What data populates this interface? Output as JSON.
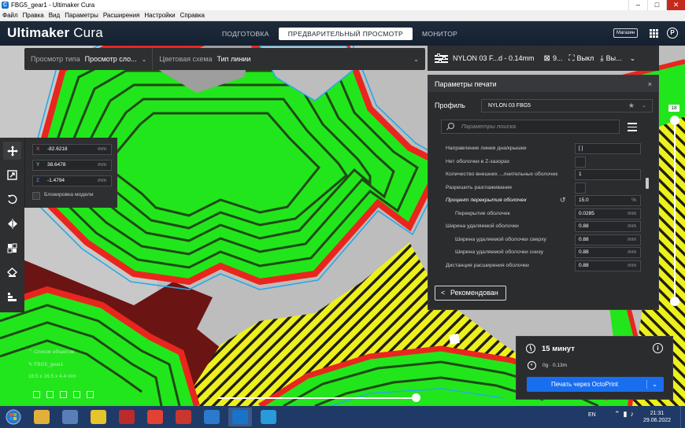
{
  "window": {
    "title": "FBG5_gear1 - Ultimaker Cura",
    "app_icon": "C",
    "minimize": "–",
    "maximize": "□",
    "close": "✕"
  },
  "menu": [
    "Файл",
    "Правка",
    "Вид",
    "Параметры",
    "Расширения",
    "Настройки",
    "Справка"
  ],
  "header": {
    "logo_bold": "Ultimaker",
    "logo_light": " Cura",
    "stages": [
      "ПОДГОТОВКА",
      "ПРЕДВАРИТЕЛЬНЫЙ ПРОСМОТР",
      "МОНИТОР"
    ],
    "active_stage": 1,
    "marketplace": "Магазин",
    "profile_letter": "P"
  },
  "view_toolbar": {
    "view_type_label": "Просмотр типа",
    "view_type_value": "Просмотр сло...",
    "color_scheme_label": "Цветовая схема",
    "color_scheme_value": "Тип линии",
    "chevron": "⌄"
  },
  "print_setup_bar": {
    "profile_summary": "NYLON 03 F...d - 0.14mm",
    "infill_value": "9...",
    "support_value": "Выкл",
    "adhesion_value": "Вы...",
    "chevron": "⌄"
  },
  "print_panel": {
    "title": "Параметры печати",
    "close": "×",
    "profile_label": "Профиль",
    "profile_value": "NYLON 03 FBG5",
    "star": "★",
    "chevron": "⌄",
    "search_placeholder": "Параметры поиска",
    "settings": [
      {
        "name": "Направление линии дна/крышки",
        "value": "[ ]",
        "unit": "",
        "type": "text",
        "sub": false,
        "highlight": false
      },
      {
        "name": "Нет оболочки в Z-зазорах",
        "value": "",
        "unit": "",
        "type": "check",
        "sub": false,
        "highlight": false
      },
      {
        "name": "Количество внешних ...лнительных оболочек",
        "value": "1",
        "unit": "",
        "type": "text",
        "sub": false,
        "highlight": false
      },
      {
        "name": "Разрешить разглаживание",
        "value": "",
        "unit": "",
        "type": "check",
        "sub": false,
        "highlight": false
      },
      {
        "name": "Процент перекрытия оболочек",
        "value": "15.0",
        "unit": "%",
        "type": "text",
        "sub": false,
        "highlight": true
      },
      {
        "name": "Перекрытие оболочек",
        "value": "0.0285",
        "unit": "mm",
        "type": "text",
        "sub": true,
        "highlight": false
      },
      {
        "name": "Ширина удаляемой оболочки",
        "value": "0.88",
        "unit": "mm",
        "type": "text",
        "sub": false,
        "highlight": false
      },
      {
        "name": "Ширина удаляемой оболочки сверху",
        "value": "0.88",
        "unit": "mm",
        "type": "text",
        "sub": true,
        "highlight": false
      },
      {
        "name": "Ширина удаляемой оболочки снизу",
        "value": "0.88",
        "unit": "mm",
        "type": "text",
        "sub": true,
        "highlight": false
      },
      {
        "name": "Дистанция расширения оболочки",
        "value": "0.88",
        "unit": "mm",
        "type": "text",
        "sub": false,
        "highlight": false
      }
    ],
    "reset_glyph": "↺",
    "recommended_button": "Рекомендован",
    "recommended_arrow": "<"
  },
  "move_tool": {
    "x_label": "X",
    "x_value": "-82.6218",
    "x_unit": "mm",
    "y_label": "Y",
    "y_value": "38.6478",
    "y_unit": "mm",
    "z_label": "Z",
    "z_value": "-1.4794",
    "z_unit": "mm",
    "lock_label": "Блокировка модели",
    "axis_colors": {
      "x": "#e0403c",
      "y": "#4fc34a",
      "z": "#3d7ce0"
    }
  },
  "tools": [
    "move-icon",
    "scale-icon",
    "rotate-icon",
    "mirror-icon",
    "per-model-settings-icon",
    "support-blocker-icon",
    "layer-icon"
  ],
  "object_list": {
    "title": "Список объектов",
    "object_name": "FBG5_gear1",
    "dimensions": "16.5 x 16.5 x 4.4 mm"
  },
  "layer_slider": {
    "current_layer": "18",
    "max_fraction": 1.0,
    "min_fraction": 0.0
  },
  "print_info": {
    "time": "15 минут",
    "material": "0g · 0.13m",
    "info_glyph": "i",
    "print_button": "Печать через OctoPrint",
    "chevron": "⌄"
  },
  "taskbar": {
    "language": "EN",
    "time": "21:31",
    "date": "29.06.2022",
    "icon_colors": [
      "#e2b03a",
      "#5a7fb8",
      "#e6c42c",
      "#bb2b2b",
      "#e34133",
      "#c7362f",
      "#2b7acb",
      "#1a73c9",
      "#2a9ad8"
    ]
  },
  "colors": {
    "wall_red": "#e8261e",
    "infill_green": "#22e61c",
    "skin_yellow": "#eef01e",
    "outline_blue": "#29a8e8",
    "dark_gap": "#4b4b4b",
    "accent_blue": "#196ef0"
  }
}
